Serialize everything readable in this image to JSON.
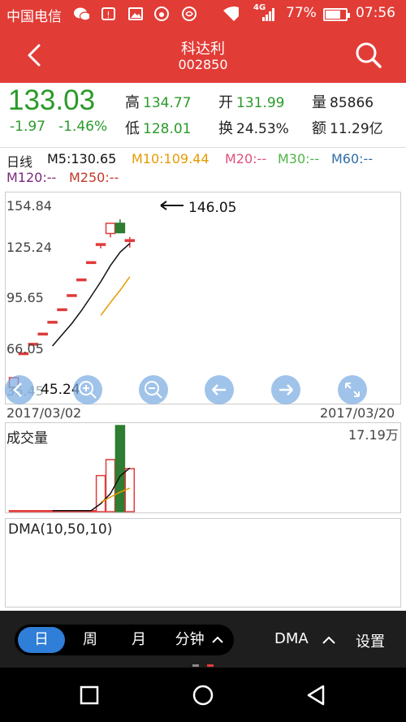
{
  "status_bar": {
    "carrier": "中国电信",
    "network": "4G",
    "battery": "77%",
    "battery_level": 0.77,
    "time": "07:56",
    "icons": [
      "wechat-icon",
      "notification-icon",
      "image-icon",
      "weibo-icon",
      "app-icon",
      "wifi-icon",
      "signal-icon",
      "battery-icon"
    ]
  },
  "header": {
    "title": "科达利",
    "code": "002850",
    "back_icon": "back-arrow-icon",
    "search_icon": "search-icon"
  },
  "quote": {
    "price": "133.03",
    "change": "-1.97",
    "change_pct": "-1.46%",
    "high_label": "高",
    "high": "134.77",
    "low_label": "低",
    "low": "128.01",
    "open_label": "开",
    "open": "131.99",
    "turnover_label": "换",
    "turnover": "24.53%",
    "volume_label": "量",
    "volume": "85866",
    "amount_label": "额",
    "amount": "11.29亿",
    "colors": {
      "down": "#2a9a2a"
    }
  },
  "ma_legend": {
    "period": "日线",
    "m5": "M5:130.65",
    "m10": "M10:109.44",
    "m20": "M20:--",
    "m30": "M30:--",
    "m60": "M60:--",
    "m120": "M120:--",
    "m250": "M250:--",
    "colors": {
      "m5": "#111111",
      "m10": "#e69a00",
      "m20": "#e0507a",
      "m30": "#4fb548",
      "m60": "#2f6ea8",
      "m120": "#7a2a7a",
      "m250": "#c0392b"
    }
  },
  "kline": {
    "y_labels": [
      "154.84",
      "125.24",
      "95.65",
      "66.05",
      "36.45"
    ],
    "min_label": "45.24",
    "max_marker": "146.05",
    "date_start": "2017/03/02",
    "date_end": "2017/03/20",
    "controls": [
      "left-double-icon",
      "zoom-in-icon",
      "zoom-out-icon",
      "prev-icon",
      "next-icon",
      "expand-icon"
    ]
  },
  "volume": {
    "title": "成交量",
    "max_label": "17.19万"
  },
  "dma": {
    "title": "DMA(10,50,10)"
  },
  "toolbar": {
    "tabs": [
      "日",
      "周",
      "月"
    ],
    "active_tab": "日",
    "minute_label": "分钟",
    "indicator_label": "DMA",
    "settings_label": "设置"
  },
  "navbar": {
    "icons": [
      "recent-apps-icon",
      "home-icon",
      "back-icon"
    ]
  },
  "chart_data": {
    "type": "candlestick",
    "ylim": [
      36.45,
      154.84
    ],
    "y_ticks": [
      154.84,
      125.24,
      95.65,
      66.05,
      36.45
    ],
    "x_range": [
      "2017/03/02",
      "2017/03/20"
    ],
    "candles": [
      {
        "open": 39.0,
        "close": 45.24,
        "high": 45.24,
        "low": 39.0
      },
      {
        "open": 61.0,
        "close": 61.0,
        "high": 61.0,
        "low": 61.0
      },
      {
        "open": 67.0,
        "close": 67.0,
        "high": 67.0,
        "low": 67.0
      },
      {
        "open": 73.5,
        "close": 73.5,
        "high": 73.5,
        "low": 73.5
      },
      {
        "open": 81.0,
        "close": 81.0,
        "high": 81.0,
        "low": 81.0
      },
      {
        "open": 89.0,
        "close": 89.0,
        "high": 89.0,
        "low": 89.0
      },
      {
        "open": 98.0,
        "close": 98.0,
        "high": 98.0,
        "low": 98.0
      },
      {
        "open": 108.0,
        "close": 108.0,
        "high": 108.0,
        "low": 108.0
      },
      {
        "open": 119.0,
        "close": 119.0,
        "high": 119.0,
        "low": 119.0
      },
      {
        "open": 130.5,
        "close": 130.5,
        "high": 130.5,
        "low": 127.5
      },
      {
        "open": 137.0,
        "close": 143.5,
        "high": 143.5,
        "low": 134.5
      },
      {
        "open": 143.5,
        "close": 137.5,
        "high": 146.05,
        "low": 137.5
      },
      {
        "open": 131.99,
        "close": 133.03,
        "high": 134.77,
        "low": 128.01
      }
    ],
    "ma5": [
      null,
      null,
      null,
      null,
      65.4,
      72.6,
      79.7,
      87.9,
      97.0,
      106.3,
      116.6,
      125.1,
      130.65
    ],
    "ma10": [
      null,
      null,
      null,
      null,
      null,
      null,
      null,
      null,
      null,
      84.8,
      93.1,
      100.8,
      109.44
    ],
    "volume_max": 17.19,
    "volume_unit": "万",
    "volume": [
      0.2,
      0.2,
      0.2,
      0.2,
      0.2,
      0.2,
      0.2,
      0.2,
      0.2,
      7.2,
      10.4,
      17.19,
      8.59
    ],
    "volume_ma5": [
      null,
      null,
      null,
      null,
      0.2,
      0.2,
      0.2,
      0.2,
      0.2,
      1.6,
      3.6,
      7.1,
      8.7
    ],
    "volume_ma10": [
      null,
      null,
      null,
      null,
      null,
      null,
      null,
      null,
      null,
      1.9,
      2.9,
      3.9,
      4.7
    ]
  }
}
